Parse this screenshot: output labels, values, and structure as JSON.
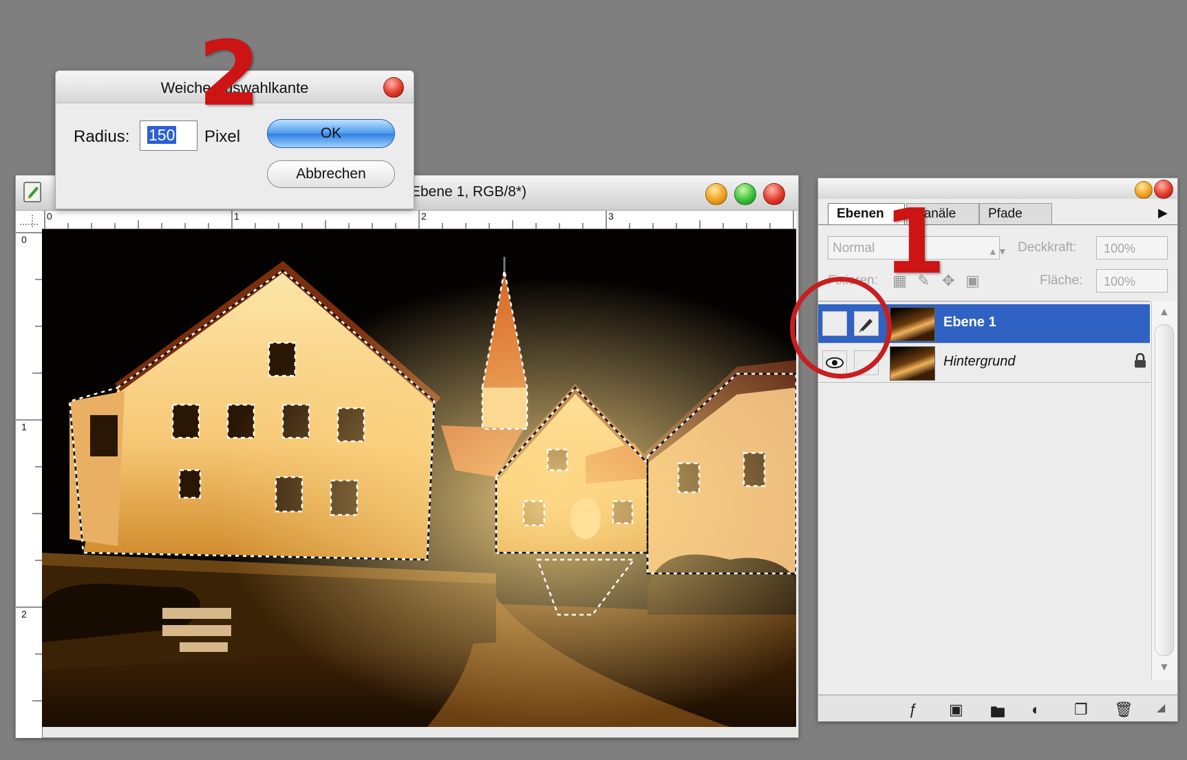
{
  "document": {
    "title": "Ebene 1, RGB/8*)",
    "ruler_top_labels": [
      "0",
      "1",
      "2",
      "3"
    ],
    "ruler_left_labels": [
      "0",
      "1",
      "2"
    ]
  },
  "dialog": {
    "title": "Weiche Auswahlkante",
    "radius_label": "Radius:",
    "radius_value": "150",
    "radius_unit": "Pixel",
    "ok_label": "OK",
    "cancel_label": "Abbrechen"
  },
  "layers_panel": {
    "tabs": [
      {
        "label": "Ebenen",
        "active": true
      },
      {
        "label": "Kanäle",
        "active": false
      },
      {
        "label": "Pfade",
        "active": false
      }
    ],
    "blend_mode": "Normal",
    "opacity_label": "Deckkraft:",
    "opacity_value": "100%",
    "fix_label": "Fixieren:",
    "fill_label": "Fläche:",
    "fill_value": "100%",
    "layers": [
      {
        "name": "Ebene 1",
        "selected": true,
        "visible": false,
        "locked": false
      },
      {
        "name": "Hintergrund",
        "selected": false,
        "visible": true,
        "locked": true
      }
    ]
  },
  "annotations": {
    "step_1": "1",
    "step_2": "2"
  },
  "colors": {
    "background": "#7f7f7f",
    "selected_layer": "#2f62c3",
    "annotation_red": "#cc1414"
  }
}
